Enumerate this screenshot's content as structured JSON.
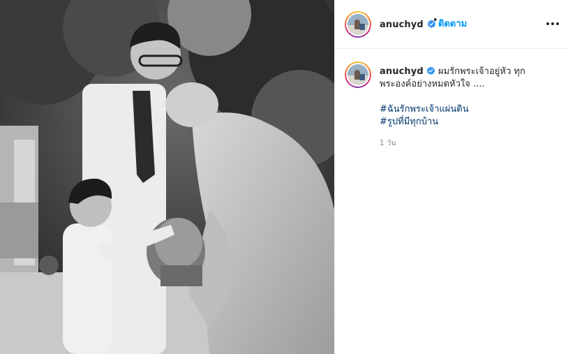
{
  "post": {
    "username": "anuchyd",
    "verified": true,
    "separator": "•",
    "follow_label": "ติดตาม",
    "more_icon": "more-horizontal-icon",
    "caption_line1": "ผมรักพระเจ้าอยู่หัว ทุก",
    "caption_line2": "พระองค์อย่างหมดหัวใจ ....",
    "hashtags": [
      "#ฉันรักพระเจ้าแผ่นดิน",
      "#รูปที่มีทุกบ้าน"
    ],
    "time_ago": "1 วัน"
  },
  "colors": {
    "link_blue": "#0095f6",
    "hashtag_blue": "#00376b",
    "verified_blue": "#3897f0",
    "muted_gray": "#8e8e8e",
    "border": "#efefef"
  }
}
